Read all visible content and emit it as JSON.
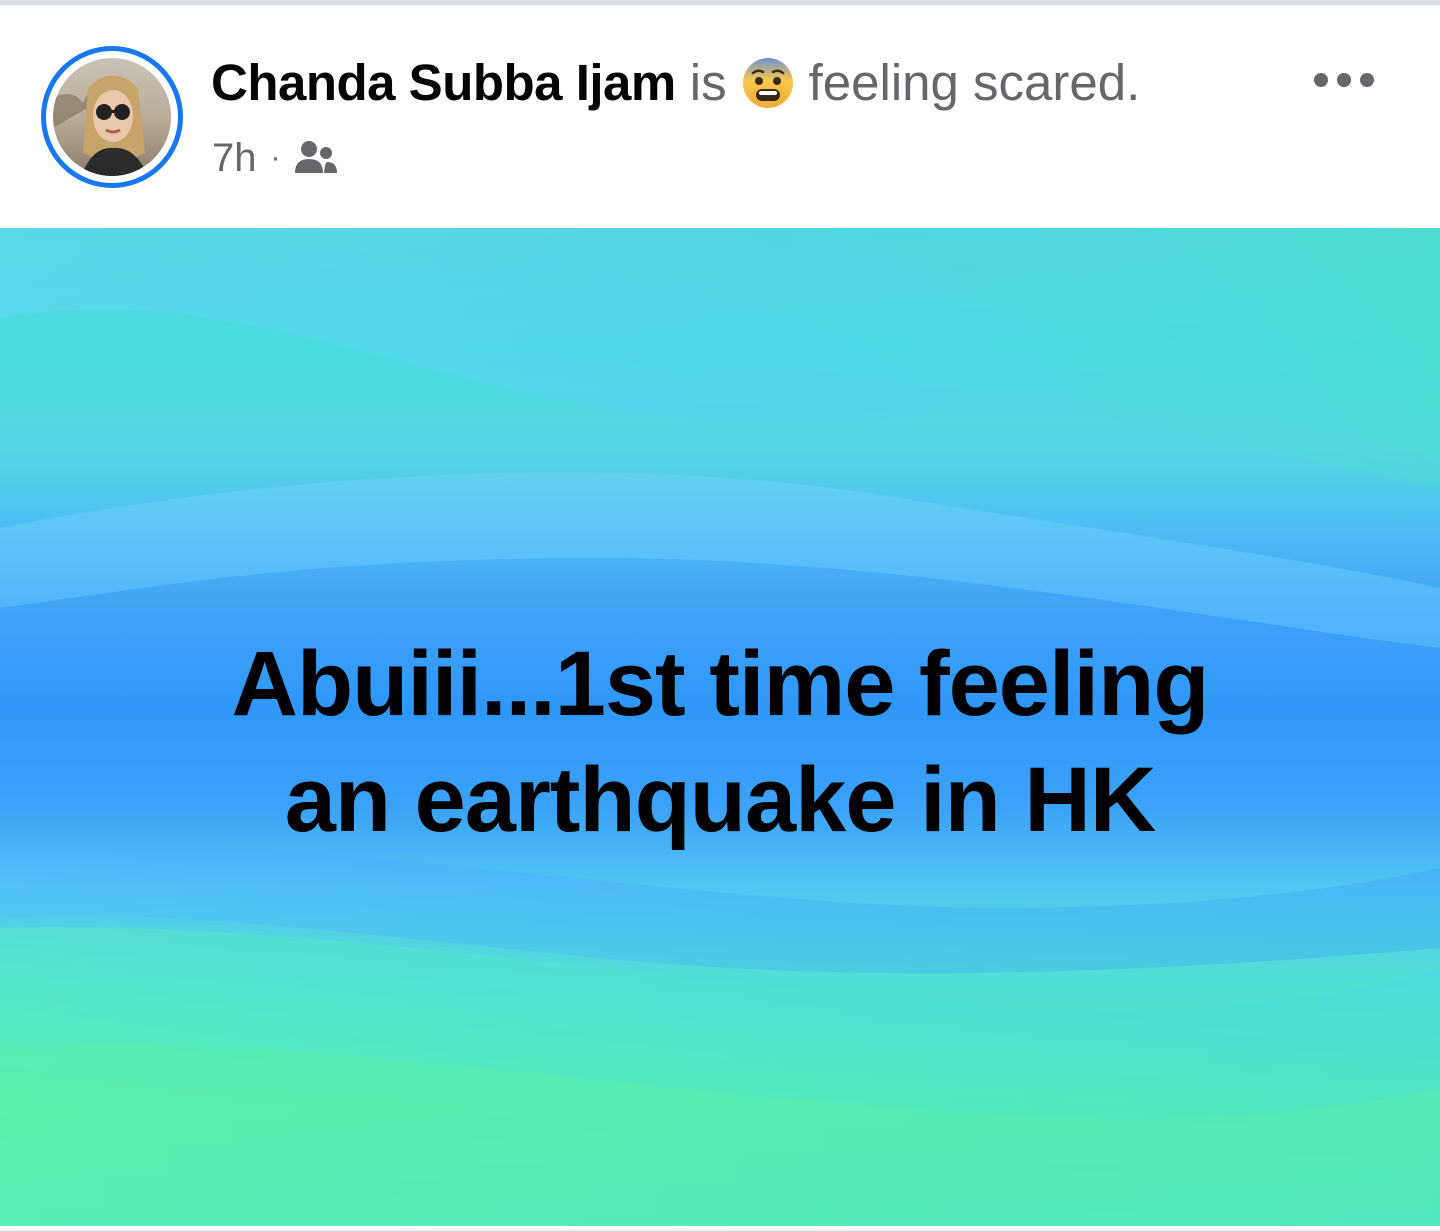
{
  "post": {
    "author": {
      "name": "Chanda Subba Ijam",
      "avatar_icon": "profile-photo"
    },
    "activity": {
      "verb": "is",
      "emoji_icon": "anxious-face-emoji",
      "feeling": "feeling scared."
    },
    "meta": {
      "time": "7h",
      "separator": "·",
      "audience_icon": "friends-audience-icon"
    },
    "menu_icon": "more-options-icon",
    "body_text": "Abuiii...1st time feeling an earthquake in HK",
    "background_colors": [
      "#4fd8d9",
      "#2f97f9",
      "#57f0a8"
    ]
  },
  "colors": {
    "accent": "#1877f2",
    "name_text": "#050505",
    "secondary_text": "#65676b"
  }
}
